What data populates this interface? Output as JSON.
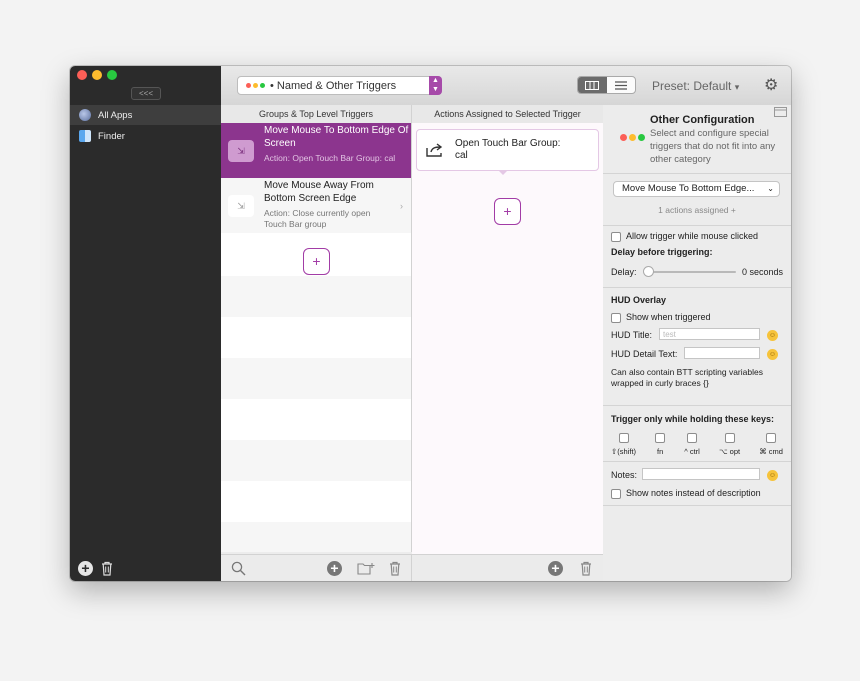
{
  "sidebar": {
    "collapse_label": "<<<",
    "apps": [
      {
        "label": "All Apps",
        "icon": "globe-icon",
        "selected": true
      },
      {
        "label": "Finder",
        "icon": "finder-icon",
        "selected": false
      }
    ]
  },
  "toolbar": {
    "trigger_type": "• Named & Other Triggers",
    "preset": "Preset: Default",
    "preset_caret": "▾"
  },
  "columns": {
    "groups_header": "Groups & Top Level Triggers",
    "actions_header": "Actions Assigned to Selected Trigger"
  },
  "triggers": [
    {
      "title": "Move Mouse To Bottom Edge Of Screen",
      "subtitle": "Action: Open Touch Bar Group: cal",
      "selected": true
    },
    {
      "title": "Move Mouse Away From Bottom Screen Edge",
      "subtitle": "Action: Close currently open Touch Bar group",
      "selected": false
    }
  ],
  "actions": [
    {
      "title": "Open Touch Bar Group: cal"
    }
  ],
  "config": {
    "title": "Other Configuration",
    "description": "Select and configure special triggers that do not fit into any other category",
    "trigger_select": "Move Mouse To Bottom Edge...",
    "actions_assigned": "1 actions assigned +",
    "allow_mouse_clicked": "Allow trigger while mouse clicked",
    "delay_heading": "Delay before triggering:",
    "delay_label": "Delay:",
    "delay_value": "0 seconds",
    "delay_fraction": 0,
    "hud_heading": "HUD Overlay",
    "hud_show": "Show when triggered",
    "hud_title_label": "HUD Title:",
    "hud_title_placeholder": "test",
    "hud_detail_label": "HUD Detail Text:",
    "hud_note": "Can also contain BTT scripting variables wrapped in curly braces {}",
    "keys_heading": "Trigger only while holding these keys:",
    "keys": [
      "⇧(shift)",
      "fn",
      "^ ctrl",
      "⌥ opt",
      "⌘ cmd"
    ],
    "notes_label": "Notes:",
    "notes_show": "Show notes instead of description"
  },
  "colors": {
    "accent": "#8c358e",
    "sidebar": "#2b2b2b",
    "traffic_red": "#fc5f57",
    "traffic_yellow": "#fdbc2e",
    "traffic_green": "#28c840"
  }
}
